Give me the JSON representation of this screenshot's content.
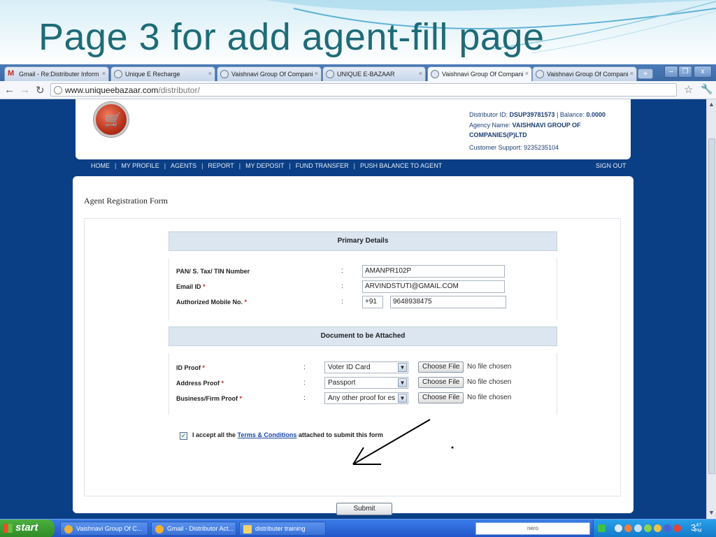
{
  "slide": {
    "title": "Page 3 for add agent-fill page"
  },
  "browser": {
    "tabs": [
      {
        "label": "Gmail - Re:Distributer Inform",
        "icon": "gmail-icon",
        "active": false
      },
      {
        "label": "Unique E Recharge",
        "icon": "globe-icon",
        "active": false
      },
      {
        "label": "Vaishnavi Group Of Compani",
        "icon": "globe-icon",
        "active": false
      },
      {
        "label": "UNIQUE E-BAZAAR",
        "icon": "globe-icon",
        "active": false
      },
      {
        "label": "Vaishnavi Group Of Compani",
        "icon": "globe-icon",
        "active": true
      },
      {
        "label": "Vaishnavi Group Of Compani",
        "icon": "globe-icon",
        "active": false
      }
    ],
    "url_host": "www.uniqueebazaar.com",
    "url_path": "/distributor/"
  },
  "site": {
    "distributor_label": "Distributor ID: ",
    "distributor_id": "DSUP39781573",
    "balance_label": " | Balance: ",
    "balance": "0.0000",
    "agency_label": "Agency Name: ",
    "agency_name": "VAISHNAVI GROUP OF",
    "agency_name_2": "COMPANIES(P)LTD",
    "support_label": "Customer Support: ",
    "support_phone": "9235235104",
    "nav": [
      "HOME",
      "MY PROFILE",
      "AGENTS",
      "REPORT",
      "MY DEPOSIT",
      "FUND TRANSFER",
      "PUSH BALANCE TO AGENT"
    ],
    "signout": "SIGN OUT"
  },
  "form": {
    "heading": "Agent Registration Form",
    "primary_title": "Primary Details",
    "pan_label": "PAN/ S. Tax/ TIN Number",
    "pan_value": "AMANPR102P",
    "email_label": "Email ID",
    "email_value": "ARVINDSTUTI@GMAIL.COM",
    "mobile_label": "Authorized Mobile No.",
    "mobile_code": "+91",
    "mobile_value": "9648938475",
    "req": "*",
    "colon": ":",
    "doc_title": "Document to be Attached",
    "id_label": "ID Proof",
    "id_value": "Voter ID Card",
    "addr_label": "Address Proof",
    "addr_value": "Passport",
    "biz_label": "Business/Firm Proof",
    "biz_value": "Any other proof for es",
    "choose_file": "Choose File",
    "no_file": "No file chosen",
    "terms_pre": "I accept all the ",
    "terms_link": "Terms & Conditions",
    "terms_post": " attached to submit this form",
    "submit": "Submit"
  },
  "taskbar": {
    "start": "start",
    "tasks": [
      "Vaishnavi Group Of C...",
      "Gmail - Distributor Act...",
      "distributer training"
    ],
    "search_label": "nero",
    "clock_hour": "3",
    "clock_min": "47",
    "clock_ampm": "PM"
  }
}
